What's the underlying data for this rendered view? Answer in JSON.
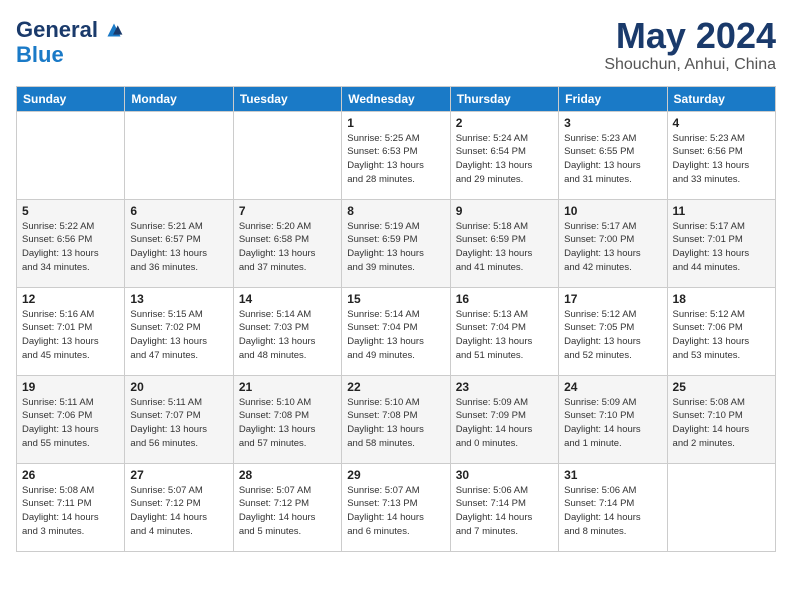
{
  "header": {
    "logo_general": "General",
    "logo_blue": "Blue",
    "month": "May 2024",
    "location": "Shouchun, Anhui, China"
  },
  "days_of_week": [
    "Sunday",
    "Monday",
    "Tuesday",
    "Wednesday",
    "Thursday",
    "Friday",
    "Saturday"
  ],
  "weeks": [
    [
      {
        "num": "",
        "info": ""
      },
      {
        "num": "",
        "info": ""
      },
      {
        "num": "",
        "info": ""
      },
      {
        "num": "1",
        "info": "Sunrise: 5:25 AM\nSunset: 6:53 PM\nDaylight: 13 hours\nand 28 minutes."
      },
      {
        "num": "2",
        "info": "Sunrise: 5:24 AM\nSunset: 6:54 PM\nDaylight: 13 hours\nand 29 minutes."
      },
      {
        "num": "3",
        "info": "Sunrise: 5:23 AM\nSunset: 6:55 PM\nDaylight: 13 hours\nand 31 minutes."
      },
      {
        "num": "4",
        "info": "Sunrise: 5:23 AM\nSunset: 6:56 PM\nDaylight: 13 hours\nand 33 minutes."
      }
    ],
    [
      {
        "num": "5",
        "info": "Sunrise: 5:22 AM\nSunset: 6:56 PM\nDaylight: 13 hours\nand 34 minutes."
      },
      {
        "num": "6",
        "info": "Sunrise: 5:21 AM\nSunset: 6:57 PM\nDaylight: 13 hours\nand 36 minutes."
      },
      {
        "num": "7",
        "info": "Sunrise: 5:20 AM\nSunset: 6:58 PM\nDaylight: 13 hours\nand 37 minutes."
      },
      {
        "num": "8",
        "info": "Sunrise: 5:19 AM\nSunset: 6:59 PM\nDaylight: 13 hours\nand 39 minutes."
      },
      {
        "num": "9",
        "info": "Sunrise: 5:18 AM\nSunset: 6:59 PM\nDaylight: 13 hours\nand 41 minutes."
      },
      {
        "num": "10",
        "info": "Sunrise: 5:17 AM\nSunset: 7:00 PM\nDaylight: 13 hours\nand 42 minutes."
      },
      {
        "num": "11",
        "info": "Sunrise: 5:17 AM\nSunset: 7:01 PM\nDaylight: 13 hours\nand 44 minutes."
      }
    ],
    [
      {
        "num": "12",
        "info": "Sunrise: 5:16 AM\nSunset: 7:01 PM\nDaylight: 13 hours\nand 45 minutes."
      },
      {
        "num": "13",
        "info": "Sunrise: 5:15 AM\nSunset: 7:02 PM\nDaylight: 13 hours\nand 47 minutes."
      },
      {
        "num": "14",
        "info": "Sunrise: 5:14 AM\nSunset: 7:03 PM\nDaylight: 13 hours\nand 48 minutes."
      },
      {
        "num": "15",
        "info": "Sunrise: 5:14 AM\nSunset: 7:04 PM\nDaylight: 13 hours\nand 49 minutes."
      },
      {
        "num": "16",
        "info": "Sunrise: 5:13 AM\nSunset: 7:04 PM\nDaylight: 13 hours\nand 51 minutes."
      },
      {
        "num": "17",
        "info": "Sunrise: 5:12 AM\nSunset: 7:05 PM\nDaylight: 13 hours\nand 52 minutes."
      },
      {
        "num": "18",
        "info": "Sunrise: 5:12 AM\nSunset: 7:06 PM\nDaylight: 13 hours\nand 53 minutes."
      }
    ],
    [
      {
        "num": "19",
        "info": "Sunrise: 5:11 AM\nSunset: 7:06 PM\nDaylight: 13 hours\nand 55 minutes."
      },
      {
        "num": "20",
        "info": "Sunrise: 5:11 AM\nSunset: 7:07 PM\nDaylight: 13 hours\nand 56 minutes."
      },
      {
        "num": "21",
        "info": "Sunrise: 5:10 AM\nSunset: 7:08 PM\nDaylight: 13 hours\nand 57 minutes."
      },
      {
        "num": "22",
        "info": "Sunrise: 5:10 AM\nSunset: 7:08 PM\nDaylight: 13 hours\nand 58 minutes."
      },
      {
        "num": "23",
        "info": "Sunrise: 5:09 AM\nSunset: 7:09 PM\nDaylight: 14 hours\nand 0 minutes."
      },
      {
        "num": "24",
        "info": "Sunrise: 5:09 AM\nSunset: 7:10 PM\nDaylight: 14 hours\nand 1 minute."
      },
      {
        "num": "25",
        "info": "Sunrise: 5:08 AM\nSunset: 7:10 PM\nDaylight: 14 hours\nand 2 minutes."
      }
    ],
    [
      {
        "num": "26",
        "info": "Sunrise: 5:08 AM\nSunset: 7:11 PM\nDaylight: 14 hours\nand 3 minutes."
      },
      {
        "num": "27",
        "info": "Sunrise: 5:07 AM\nSunset: 7:12 PM\nDaylight: 14 hours\nand 4 minutes."
      },
      {
        "num": "28",
        "info": "Sunrise: 5:07 AM\nSunset: 7:12 PM\nDaylight: 14 hours\nand 5 minutes."
      },
      {
        "num": "29",
        "info": "Sunrise: 5:07 AM\nSunset: 7:13 PM\nDaylight: 14 hours\nand 6 minutes."
      },
      {
        "num": "30",
        "info": "Sunrise: 5:06 AM\nSunset: 7:14 PM\nDaylight: 14 hours\nand 7 minutes."
      },
      {
        "num": "31",
        "info": "Sunrise: 5:06 AM\nSunset: 7:14 PM\nDaylight: 14 hours\nand 8 minutes."
      },
      {
        "num": "",
        "info": ""
      }
    ]
  ]
}
